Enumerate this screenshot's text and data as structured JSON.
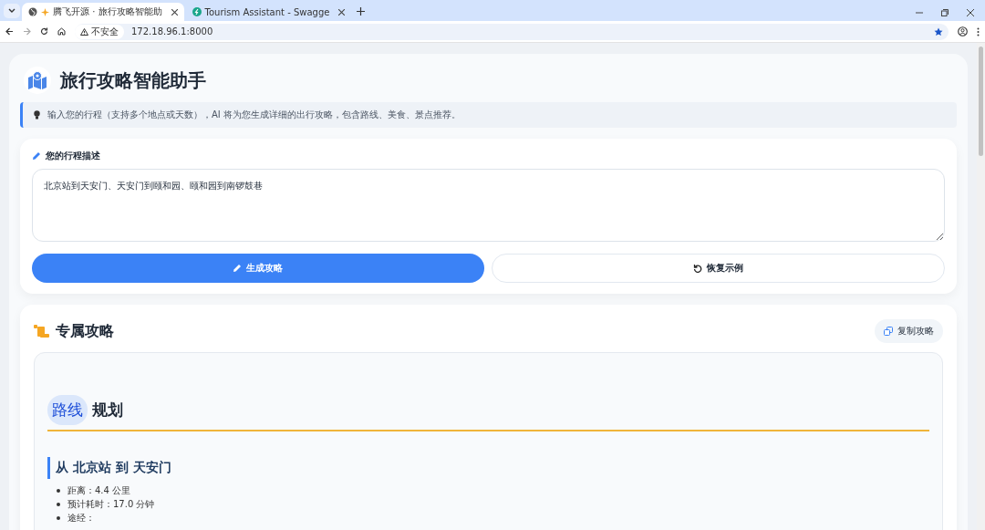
{
  "browser": {
    "tabs": [
      {
        "title": "腾飞开源 · 旅行攻略智能助",
        "selected": true
      },
      {
        "title": "Tourism Assistant - Swagge",
        "selected": false
      }
    ],
    "address": {
      "security": "不安全",
      "url": "172.18.96.1:8000"
    }
  },
  "page": {
    "title": "旅行攻略智能助手",
    "info": "输入您的行程（支持多个地点或天数），AI 将为您生成详细的出行攻略，包含路线、美食、景点推荐。",
    "input": {
      "label": "您的行程描述",
      "value": "北京站到天安门、天安门到颐和园、颐和园到南锣鼓巷"
    },
    "buttons": [
      {
        "label": "生成攻略",
        "kind": "primary"
      },
      {
        "label": "恢复示例",
        "kind": "secondary"
      }
    ],
    "result": {
      "title": "专属攻略",
      "copy_label": "复制攻略",
      "section_heading": {
        "highlight": "路线",
        "rest": "规划"
      },
      "routes": [
        {
          "heading": "从 北京站 到 天安门",
          "items": [
            "距离：4.4 公里",
            "预计耗时：17.0 分钟",
            "途经："
          ]
        }
      ]
    }
  }
}
